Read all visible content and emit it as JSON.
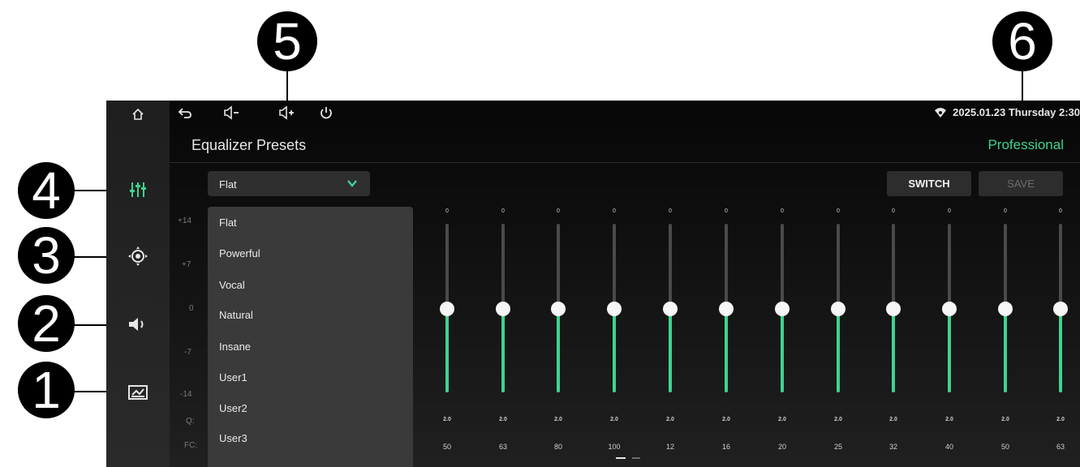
{
  "callouts": [
    "5",
    "6",
    "4",
    "3",
    "2",
    "1"
  ],
  "status": {
    "back_icon": "back-icon",
    "vol_down_icon": "volume-down-icon",
    "vol_up_icon": "volume-up-icon",
    "power_icon": "power-icon",
    "wifi_icon": "wifi-icon",
    "clock": "2025.01.23 Thursday 2:30"
  },
  "sidebar": {
    "home_icon": "home-icon",
    "items": [
      "equalizer-icon",
      "sound-position-icon",
      "speaker-icon",
      "crossover-icon"
    ]
  },
  "header": {
    "title": "Equalizer Presets",
    "mode": "Professional"
  },
  "preset": {
    "selected": "Flat",
    "options": [
      "Flat",
      "Powerful",
      "Vocal",
      "Natural",
      "Insane",
      "User1",
      "User2",
      "User3"
    ]
  },
  "buttons": {
    "switch": "SWITCH",
    "save": "SAVE"
  },
  "scale": {
    "labels": [
      "+14",
      "+7",
      "0",
      "-7",
      "-14"
    ],
    "q_label": "Q:",
    "fc_label": "FC:"
  },
  "bands": [
    {
      "gain": "0",
      "q": "2.0",
      "fc": "50"
    },
    {
      "gain": "0",
      "q": "2.0",
      "fc": "63"
    },
    {
      "gain": "0",
      "q": "2.0",
      "fc": "80"
    },
    {
      "gain": "0",
      "q": "2.0",
      "fc": "100"
    },
    {
      "gain": "0",
      "q": "2.0",
      "fc": "12"
    },
    {
      "gain": "0",
      "q": "2.0",
      "fc": "16"
    },
    {
      "gain": "0",
      "q": "2.0",
      "fc": "20"
    },
    {
      "gain": "0",
      "q": "2.0",
      "fc": "25"
    },
    {
      "gain": "0",
      "q": "2.0",
      "fc": "32"
    },
    {
      "gain": "0",
      "q": "2.0",
      "fc": "40"
    },
    {
      "gain": "0",
      "q": "2.0",
      "fc": "50"
    },
    {
      "gain": "0",
      "q": "2.0",
      "fc": "63"
    }
  ],
  "colors": {
    "accent": "#3fd38f",
    "panel": "#2f2f2f",
    "dropdown": "#3a3a3a",
    "background": "#0a0a0a"
  }
}
